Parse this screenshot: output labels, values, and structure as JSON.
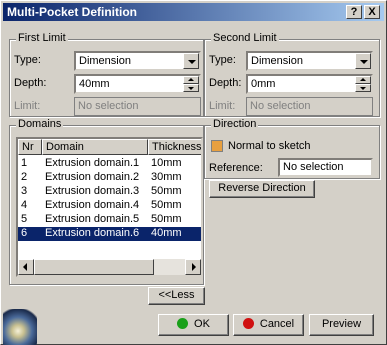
{
  "window": {
    "title": "Multi-Pocket Definition",
    "help_label": "?",
    "close_label": "X"
  },
  "first_limit": {
    "group_title": "First Limit",
    "type_label": "Type:",
    "type_value": "Dimension",
    "depth_label": "Depth:",
    "depth_value": "40mm",
    "limit_label": "Limit:",
    "limit_value": "No selection"
  },
  "second_limit": {
    "group_title": "Second Limit",
    "type_label": "Type:",
    "type_value": "Dimension",
    "depth_label": "Depth:",
    "depth_value": "0mm",
    "limit_label": "Limit:",
    "limit_value": "No selection"
  },
  "domains": {
    "group_title": "Domains",
    "columns": [
      "Nr",
      "Domain",
      "Thickness"
    ],
    "rows": [
      {
        "nr": "1",
        "domain": "Extrusion domain.1",
        "thickness": "10mm"
      },
      {
        "nr": "2",
        "domain": "Extrusion domain.2",
        "thickness": "30mm"
      },
      {
        "nr": "3",
        "domain": "Extrusion domain.3",
        "thickness": "50mm"
      },
      {
        "nr": "4",
        "domain": "Extrusion domain.4",
        "thickness": "50mm"
      },
      {
        "nr": "5",
        "domain": "Extrusion domain.5",
        "thickness": "50mm"
      },
      {
        "nr": "6",
        "domain": "Extrusion domain.6",
        "thickness": "40mm"
      }
    ],
    "selected_row": 6
  },
  "direction": {
    "group_title": "Direction",
    "normal_label": "Normal to sketch",
    "reference_label": "Reference:",
    "reference_value": "No selection",
    "reverse_label": "Reverse Direction"
  },
  "less_label": "<<Less",
  "buttons": {
    "ok": "OK",
    "cancel": "Cancel",
    "preview": "Preview"
  },
  "colors": {
    "ok_dot": "#1aa01a",
    "cancel_dot": "#d01010",
    "selection": "#0a246a",
    "checkbox": "#e8a040"
  }
}
